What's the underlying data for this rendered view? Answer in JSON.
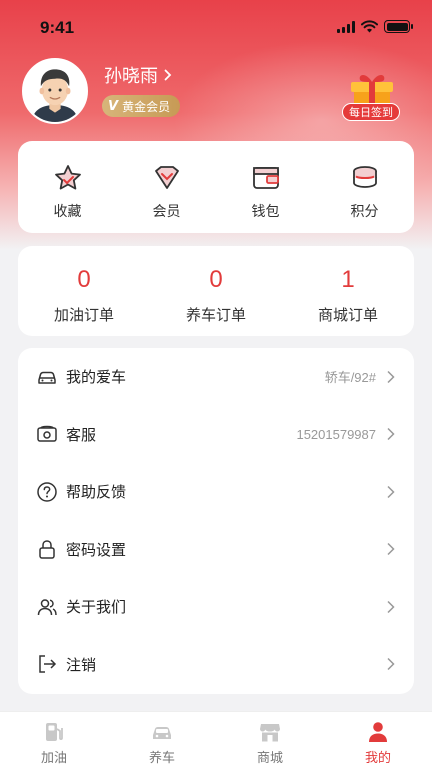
{
  "status_bar": {
    "time": "9:41"
  },
  "profile": {
    "name": "孙晓雨",
    "member_level": "黄金会员",
    "member_badge_mark": "V",
    "checkin_label": "每日签到"
  },
  "quick_actions": [
    {
      "label": "收藏",
      "icon": "star-icon"
    },
    {
      "label": "会员",
      "icon": "diamond-icon"
    },
    {
      "label": "钱包",
      "icon": "wallet-icon"
    },
    {
      "label": "积分",
      "icon": "coins-icon"
    }
  ],
  "orders": [
    {
      "count": "0",
      "label": "加油订单"
    },
    {
      "count": "0",
      "label": "养车订单"
    },
    {
      "count": "1",
      "label": "商城订单"
    }
  ],
  "menu": [
    {
      "title": "我的爱车",
      "value": "轿车/92#",
      "icon": "car-icon"
    },
    {
      "title": "客服",
      "value": "15201579987",
      "icon": "phone-icon"
    },
    {
      "title": "帮助反馈",
      "value": "",
      "icon": "help-icon"
    },
    {
      "title": "密码设置",
      "value": "",
      "icon": "lock-icon"
    },
    {
      "title": "关于我们",
      "value": "",
      "icon": "users-icon"
    },
    {
      "title": "注销",
      "value": "",
      "icon": "logout-icon"
    }
  ],
  "tabbar": [
    {
      "label": "加油",
      "icon": "fuel-icon",
      "active": false
    },
    {
      "label": "养车",
      "icon": "car-icon",
      "active": false
    },
    {
      "label": "商城",
      "icon": "shop-icon",
      "active": false
    },
    {
      "label": "我的",
      "icon": "user-icon",
      "active": true
    }
  ],
  "colors": {
    "accent": "#e23b3b",
    "gold": "#c79a55",
    "text": "#222222",
    "muted": "#999999"
  }
}
